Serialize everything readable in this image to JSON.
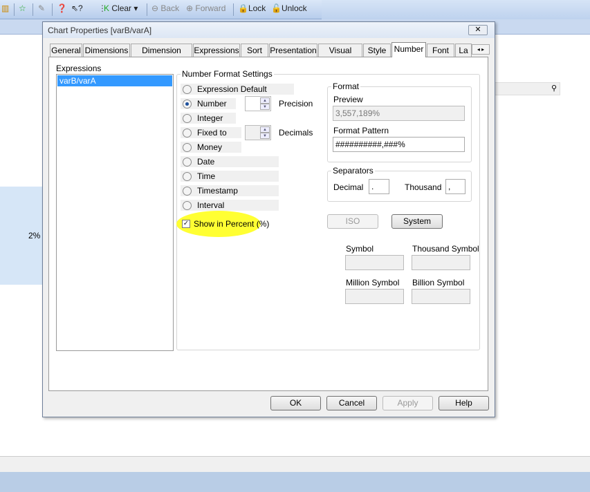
{
  "toolbar": {
    "clear": "Clear",
    "back": "Back",
    "forward": "Forward",
    "lock": "Lock",
    "unlock": "Unlock"
  },
  "background": {
    "value_label": "2%"
  },
  "dialog": {
    "title": "Chart Properties [varB/varA]",
    "close": "✕",
    "tabs": [
      {
        "label": "General"
      },
      {
        "label": "Dimensions"
      },
      {
        "label": "Dimension Limits"
      },
      {
        "label": "Expressions"
      },
      {
        "label": "Sort"
      },
      {
        "label": "Presentation"
      },
      {
        "label": "Visual Cues"
      },
      {
        "label": "Style"
      },
      {
        "label": "Number",
        "selected": true
      },
      {
        "label": "Font"
      },
      {
        "label": "La"
      }
    ],
    "expressions": {
      "label": "Expressions",
      "items": [
        "varB/varA"
      ]
    },
    "number_format": {
      "label": "Number Format Settings",
      "options": [
        "Expression Default",
        "Number",
        "Integer",
        "Fixed to",
        "Money",
        "Date",
        "Time",
        "Timestamp",
        "Interval"
      ],
      "selected": "Number",
      "precision_label": "Precision",
      "decimals_label": "Decimals",
      "show_percent_label": "Show in Percent (%)",
      "show_percent_checked": true,
      "highlight_color": "#ffff33"
    },
    "format": {
      "label": "Format",
      "preview_label": "Preview",
      "preview_value": "3,557,189%",
      "pattern_label": "Format Pattern",
      "pattern_value": "##########,###%"
    },
    "separators": {
      "label": "Separators",
      "decimal_label": "Decimal",
      "decimal_value": ".",
      "thousand_label": "Thousand",
      "thousand_value": ","
    },
    "iso": "ISO",
    "system": "System",
    "symbols": {
      "symbol": "Symbol",
      "thousand": "Thousand Symbol",
      "million": "Million Symbol",
      "billion": "Billion Symbol"
    },
    "buttons": {
      "ok": "OK",
      "cancel": "Cancel",
      "apply": "Apply",
      "help": "Help"
    }
  }
}
